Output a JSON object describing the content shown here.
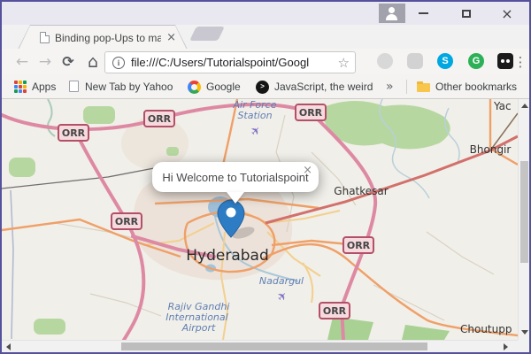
{
  "window": {
    "app": "Chrome browser window"
  },
  "icons": {
    "back": "←",
    "forward": "→",
    "refresh": "⟳",
    "home": "⌂",
    "info": "i",
    "star": "☆",
    "menu": "⋮",
    "overflow": "»",
    "skype": "S",
    "grammarly": "G",
    "js": ">",
    "plane": "✈",
    "tab_close": "×",
    "popup_close": "×",
    "window_close": "×"
  },
  "tab": {
    "title": "Binding pop-Ups to mark"
  },
  "address": {
    "url": "file:///C:/Users/Tutorialspoint/Googl"
  },
  "bookmarks": {
    "apps": "Apps",
    "yahoo": "New Tab by Yahoo",
    "google": "Google",
    "javascript": "JavaScript, the weird",
    "other": "Other bookmarks"
  },
  "map": {
    "orr": "ORR",
    "labels": {
      "hyderabad": "Hyderabad",
      "ghatkesar": "Ghatkesar",
      "bhongir": "Bhongir",
      "yac": "Yac",
      "choutupp": "Choutupp",
      "air_force": [
        "Air Force",
        "Station"
      ],
      "nadargul": "Nadargul",
      "airport": [
        "Rajiv Gandhi",
        "International",
        "Airport"
      ]
    },
    "popup": {
      "text": "Hi Welcome to Tutorialspoint"
    },
    "colors": {
      "marker_blue": "#2e7dc4",
      "trunk_pink": "#de89a4",
      "highway_orange": "#efa068",
      "warangal_red": "#d2706b",
      "park_green": "#b7d7a1",
      "water_blue": "#a8cfe0",
      "orr_border": "#b25068",
      "orr_fill": "#f6dade",
      "aero_label_blue": "#5f7fb3",
      "city_label": "#2a2a2a"
    }
  }
}
